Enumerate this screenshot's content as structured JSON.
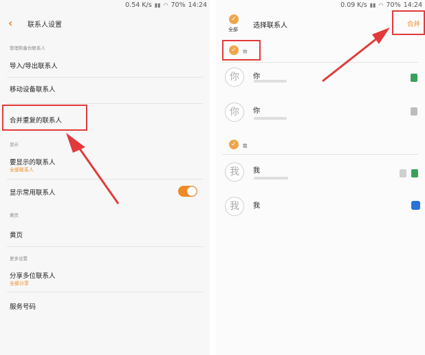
{
  "left": {
    "status": {
      "speed": "0.54 K/s",
      "battery": "70%",
      "time": "14:24"
    },
    "title": "联系人设置",
    "back_icon": "chevron-left-icon",
    "section_manage": "管理和备份联系人",
    "item_import_export": "导入/导出联系人",
    "item_move": "移动设备联系人",
    "item_merge": "合并重复的联系人",
    "section_display": "显示",
    "item_contacts_to_show": "要显示的联系人",
    "item_contacts_to_show_sub": "全部联系人",
    "item_show_frequent": "显示常用联系人",
    "toggle_on": true,
    "section_yellow": "黄页",
    "item_yellow_pages": "黄页",
    "section_more": "更多设置",
    "item_share_multiple": "分享多位联系人",
    "item_share_multiple_sub": "全部分享",
    "item_service_numbers": "服务号码"
  },
  "right": {
    "status": {
      "speed": "0.09 K/s",
      "battery": "70%",
      "time": "14:24"
    },
    "select_all_label": "全部",
    "title": "选择联系人",
    "merge_button": "合并",
    "group1_label": "你",
    "contact1_avatar": "你",
    "contact1_name": "你",
    "contact2_avatar": "你",
    "contact2_name": "你",
    "group2_label": "我",
    "contact3_avatar": "我",
    "contact3_name": "我",
    "contact4_avatar": "我",
    "contact4_name": "我"
  },
  "colors": {
    "accent": "#f08a24",
    "highlight": "#e23a3a"
  }
}
